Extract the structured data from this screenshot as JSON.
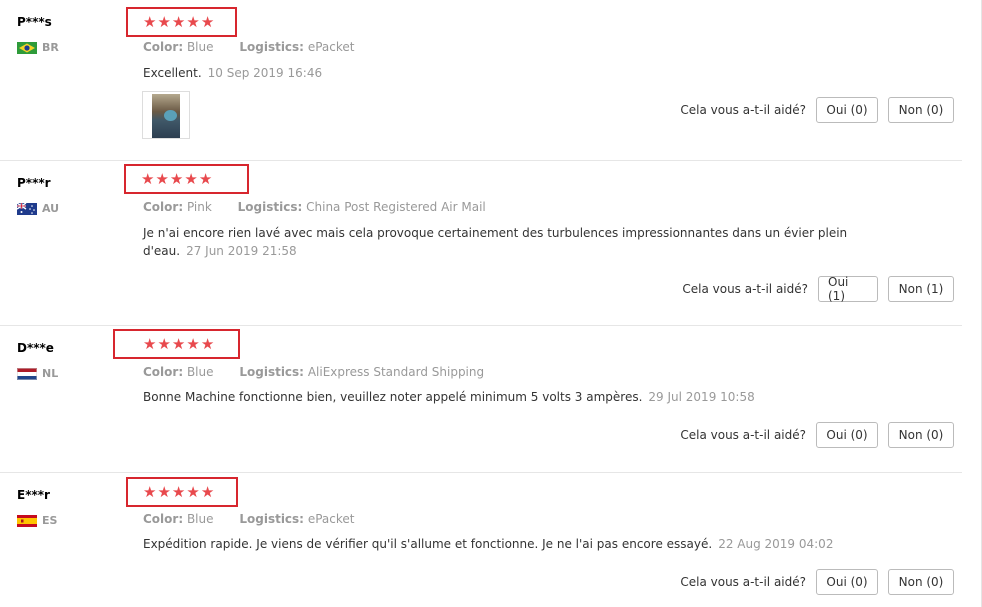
{
  "labels": {
    "color": "Color:",
    "logistics": "Logistics:",
    "helpful_question": "Cela vous a-t-il aidé?"
  },
  "rating_stars": 5,
  "colors": {
    "star": "#e8494d",
    "highlight_box": "#d7262e"
  },
  "reviews": [
    {
      "user": "P***s",
      "country": "BR",
      "flag_icon": "brazil-flag-icon",
      "color": "Blue",
      "logistics": "ePacket",
      "text": "Excellent.",
      "date": "10 Sep 2019 16:46",
      "has_photo": true,
      "yes_label": "Oui (0)",
      "no_label": "Non (0)"
    },
    {
      "user": "P***r",
      "country": "AU",
      "flag_icon": "australia-flag-icon",
      "color": "Pink",
      "logistics": "China Post Registered Air Mail",
      "text_line1": "Je n'ai encore rien lavé avec mais cela provoque certainement des turbulences impressionnantes dans un évier plein",
      "text_line2": "d'eau.",
      "date": "27 Jun 2019 21:58",
      "yes_label": "Oui (1)",
      "no_label": "Non (1)"
    },
    {
      "user": "D***e",
      "country": "NL",
      "flag_icon": "netherlands-flag-icon",
      "color": "Blue",
      "logistics": "AliExpress Standard Shipping",
      "text": "Bonne Machine fonctionne bien, veuillez noter appelé minimum 5 volts 3 ampères.",
      "date": "29 Jul 2019 10:58",
      "yes_label": "Oui (0)",
      "no_label": "Non (0)"
    },
    {
      "user": "E***r",
      "country": "ES",
      "flag_icon": "spain-flag-icon",
      "color": "Blue",
      "logistics": "ePacket",
      "text": "Expédition rapide. Je viens de vérifier qu'il s'allume et fonctionne. Je ne l'ai pas encore essayé.",
      "date": "22 Aug 2019 04:02",
      "yes_label": "Oui (0)",
      "no_label": "Non (0)"
    }
  ]
}
